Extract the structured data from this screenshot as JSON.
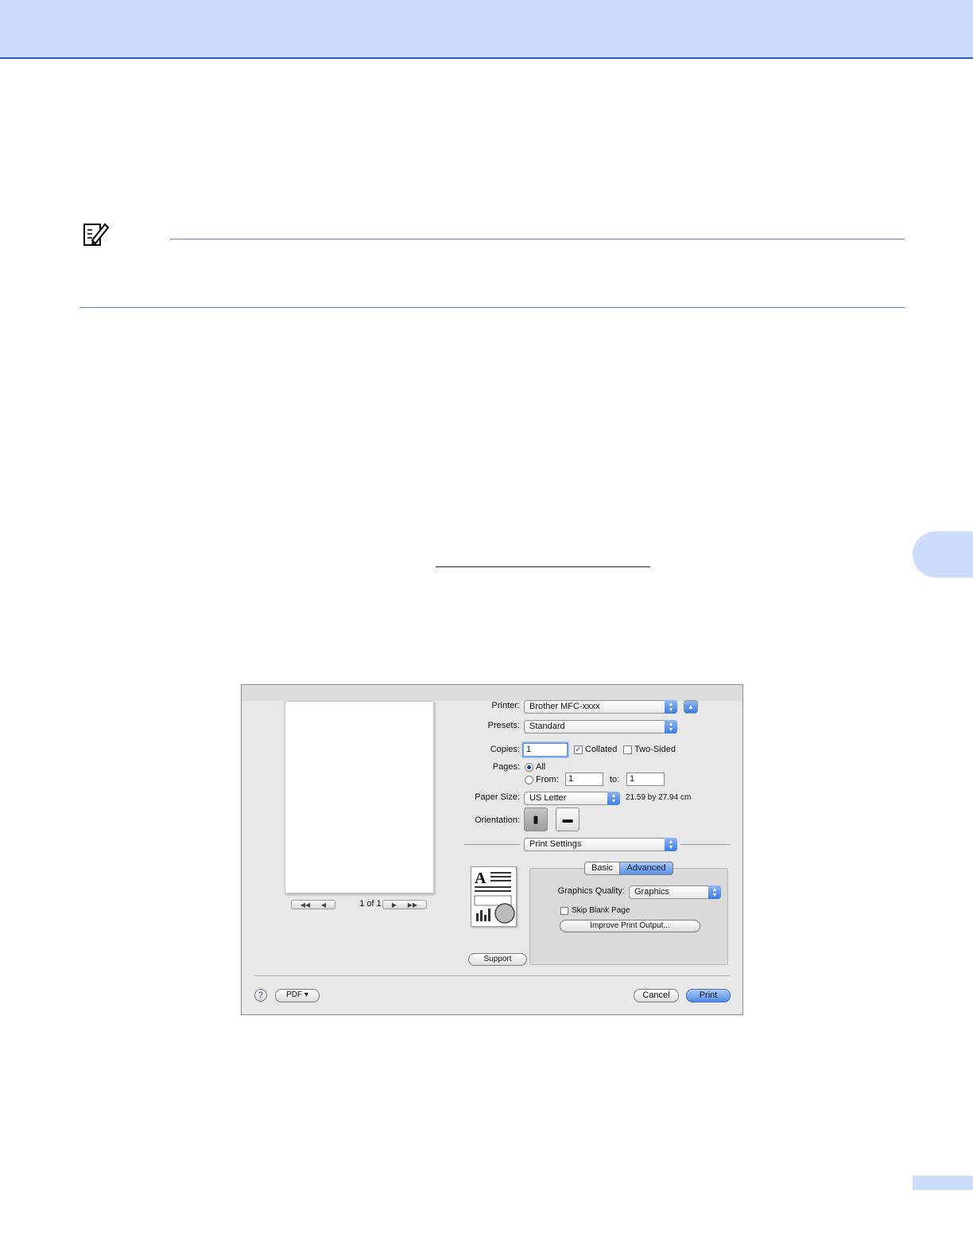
{
  "dialog": {
    "printer_label": "Printer:",
    "printer_value": "Brother MFC-xxxx",
    "presets_label": "Presets:",
    "presets_value": "Standard",
    "copies_label": "Copies:",
    "copies_value": "1",
    "collated_label": "Collated",
    "two_sided_label": "Two-Sided",
    "pages_label": "Pages:",
    "pages_all_label": "All",
    "pages_from_label": "From:",
    "pages_from_value": "1",
    "pages_to_label": "to:",
    "pages_to_value": "1",
    "paper_size_label": "Paper Size:",
    "paper_size_value": "US Letter",
    "paper_dimensions": "21.59 by 27.94 cm",
    "orientation_label": "Orientation:",
    "panel_popup_value": "Print Settings",
    "tab_basic": "Basic",
    "tab_advanced": "Advanced",
    "graphics_quality_label": "Graphics Quality:",
    "graphics_quality_value": "Graphics",
    "skip_blank_label": "Skip Blank Page",
    "improve_button": "Improve Print Output...",
    "support_button": "Support",
    "pager_text": "1 of 1",
    "help_glyph": "?",
    "pdf_button": "PDF ▾",
    "cancel_button": "Cancel",
    "print_button": "Print"
  },
  "colors": {
    "header_band": "#cddcfb",
    "rule": "#5b86d4",
    "accent_blue": "#4f8be6"
  }
}
